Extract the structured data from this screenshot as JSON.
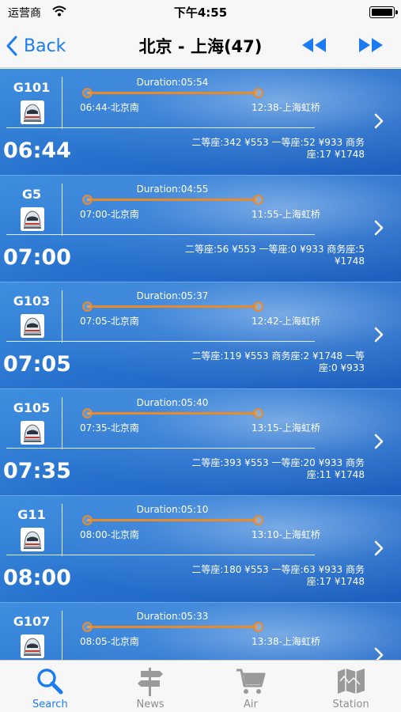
{
  "status_bar": {
    "carrier": "运营商",
    "time": "下午4:55"
  },
  "nav": {
    "back_label": "Back",
    "title": "北京 - 上海(47)"
  },
  "trains": [
    {
      "train_no": "G101",
      "duration": "Duration:05:54",
      "departure": "06:44-北京南",
      "arrival": "12:38-上海虹桥",
      "depart_time": "06:44",
      "seats": "二等座:342 ¥553 一等座:52 ¥933 商务座:17 ¥1748"
    },
    {
      "train_no": "G5",
      "duration": "Duration:04:55",
      "departure": "07:00-北京南",
      "arrival": "11:55-上海虹桥",
      "depart_time": "07:00",
      "seats": "二等座:56 ¥553 一等座:0 ¥933 商务座:5 ¥1748"
    },
    {
      "train_no": "G103",
      "duration": "Duration:05:37",
      "departure": "07:05-北京南",
      "arrival": "12:42-上海虹桥",
      "depart_time": "07:05",
      "seats": "二等座:119 ¥553 商务座:2 ¥1748 一等座:0 ¥933"
    },
    {
      "train_no": "G105",
      "duration": "Duration:05:40",
      "departure": "07:35-北京南",
      "arrival": "13:15-上海虹桥",
      "depart_time": "07:35",
      "seats": "二等座:393 ¥553 一等座:20 ¥933 商务座:11 ¥1748"
    },
    {
      "train_no": "G11",
      "duration": "Duration:05:10",
      "departure": "08:00-北京南",
      "arrival": "13:10-上海虹桥",
      "depart_time": "08:00",
      "seats": "二等座:180 ¥553 一等座:63 ¥933 商务座:17 ¥1748"
    },
    {
      "train_no": "G107",
      "duration": "Duration:05:33",
      "departure": "08:05-北京南",
      "arrival": "13:38-上海虹桥",
      "depart_time": "",
      "seats": ""
    }
  ],
  "tabs": [
    {
      "label": "Search",
      "icon": "search-icon",
      "active": true
    },
    {
      "label": "News",
      "icon": "signpost-icon",
      "active": false
    },
    {
      "label": "Air",
      "icon": "cart-icon",
      "active": false
    },
    {
      "label": "Station",
      "icon": "map-icon",
      "active": false
    }
  ],
  "colors": {
    "accent": "#1a7cf5",
    "route": "#e88a2a",
    "row_bg": "#2670cd",
    "inactive_tab": "#8e8e8e"
  }
}
